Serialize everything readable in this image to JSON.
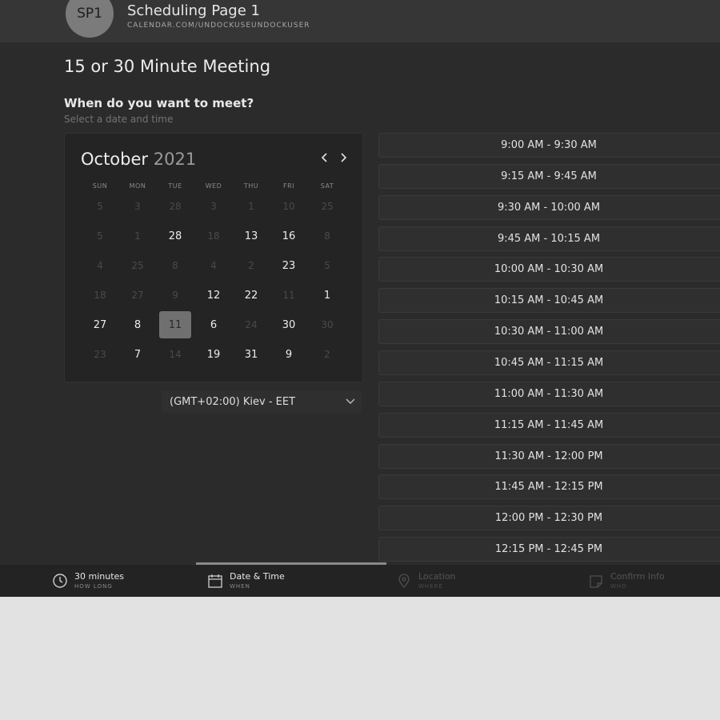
{
  "header": {
    "avatar_initials": "SP1",
    "page_name": "Scheduling Page 1",
    "url": "CALENDAR.COM/UNDOCKUSEUNDOCKUSER"
  },
  "title": "15 or 30 Minute Meeting",
  "prompt": {
    "question": "When do you want to meet?",
    "subtitle": "Select a date and time"
  },
  "calendar": {
    "month": "October",
    "year": "2021",
    "prev_icon": "chevron-left-icon",
    "next_icon": "chevron-right-icon",
    "weekdays": [
      "SUN",
      "MON",
      "TUE",
      "WED",
      "THU",
      "FRI",
      "SAT"
    ],
    "weeks": [
      [
        {
          "d": "5",
          "a": false
        },
        {
          "d": "3",
          "a": false
        },
        {
          "d": "28",
          "a": false
        },
        {
          "d": "3",
          "a": false
        },
        {
          "d": "1",
          "a": false
        },
        {
          "d": "10",
          "a": false
        },
        {
          "d": "25",
          "a": false
        }
      ],
      [
        {
          "d": "5",
          "a": false
        },
        {
          "d": "1",
          "a": false
        },
        {
          "d": "28",
          "a": true
        },
        {
          "d": "18",
          "a": false
        },
        {
          "d": "13",
          "a": true
        },
        {
          "d": "16",
          "a": true
        },
        {
          "d": "8",
          "a": false
        }
      ],
      [
        {
          "d": "4",
          "a": false
        },
        {
          "d": "25",
          "a": false
        },
        {
          "d": "8",
          "a": false
        },
        {
          "d": "4",
          "a": false
        },
        {
          "d": "2",
          "a": false
        },
        {
          "d": "23",
          "a": true
        },
        {
          "d": "5",
          "a": false
        }
      ],
      [
        {
          "d": "18",
          "a": false
        },
        {
          "d": "27",
          "a": false
        },
        {
          "d": "9",
          "a": false
        },
        {
          "d": "12",
          "a": true
        },
        {
          "d": "22",
          "a": true
        },
        {
          "d": "11",
          "a": false
        },
        {
          "d": "1",
          "a": true
        }
      ],
      [
        {
          "d": "27",
          "a": true
        },
        {
          "d": "8",
          "a": true
        },
        {
          "d": "11",
          "a": true,
          "s": true
        },
        {
          "d": "6",
          "a": true
        },
        {
          "d": "24",
          "a": false
        },
        {
          "d": "30",
          "a": true
        },
        {
          "d": "30",
          "a": false
        }
      ],
      [
        {
          "d": "23",
          "a": false
        },
        {
          "d": "7",
          "a": true
        },
        {
          "d": "14",
          "a": false
        },
        {
          "d": "19",
          "a": true
        },
        {
          "d": "31",
          "a": true
        },
        {
          "d": "9",
          "a": true
        },
        {
          "d": "2",
          "a": false
        }
      ]
    ]
  },
  "timezone": {
    "label": "(GMT+02:00) Kiev - EET",
    "icon": "chevron-down-icon"
  },
  "time_slots": [
    "9:00 AM - 9:30 AM",
    "9:15 AM - 9:45 AM",
    "9:30 AM - 10:00 AM",
    "9:45 AM - 10:15 AM",
    "10:00 AM - 10:30 AM",
    "10:15 AM - 10:45 AM",
    "10:30 AM - 11:00 AM",
    "10:45 AM - 11:15 AM",
    "11:00 AM - 11:30 AM",
    "11:15 AM - 11:45 AM",
    "11:30 AM - 12:00 PM",
    "11:45 AM - 12:15 PM",
    "12:00 PM - 12:30 PM",
    "12:15 PM - 12:45 PM"
  ],
  "steps": [
    {
      "label": "30 minutes",
      "sub": "HOW LONG",
      "icon": "clock-icon",
      "active": true
    },
    {
      "label": "Date & Time",
      "sub": "WHEN",
      "icon": "calendar-icon",
      "active": true
    },
    {
      "label": "Location",
      "sub": "WHERE",
      "icon": "location-pin-icon",
      "active": false
    },
    {
      "label": "Confirm Info",
      "sub": "WHO",
      "icon": "note-icon",
      "active": false
    }
  ],
  "colors": {
    "app_bg": "#2b2b2b",
    "header_bg": "#363636",
    "slot_bg": "#2f2f2f",
    "selected_day": "#707070",
    "page_bg": "#e2e2e2"
  }
}
